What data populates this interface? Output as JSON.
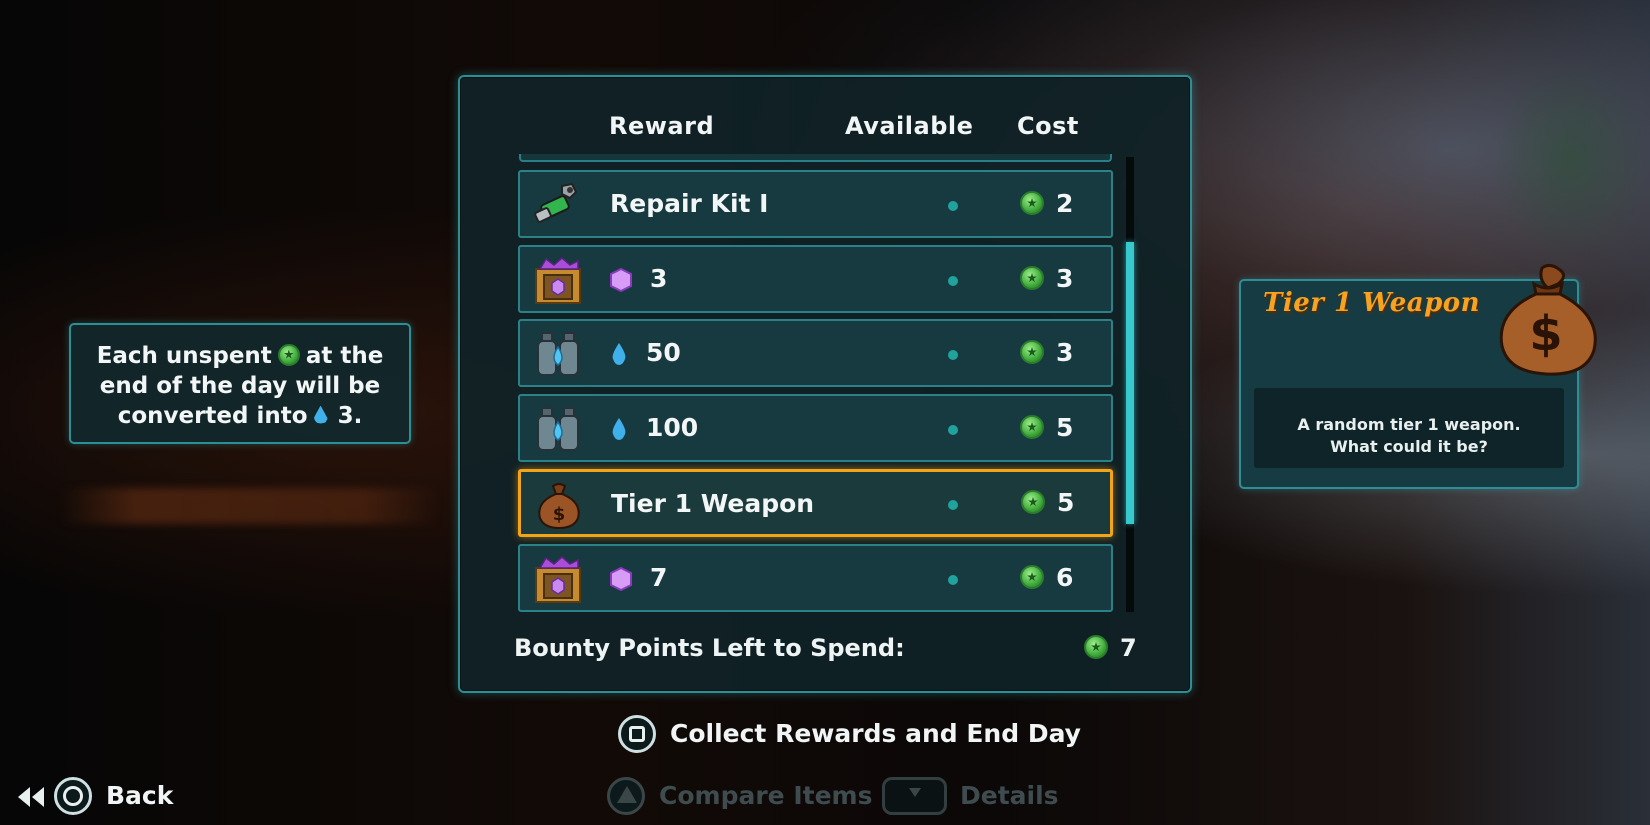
{
  "columns": {
    "reward": "Reward",
    "available": "Available",
    "cost": "Cost"
  },
  "rewards": [
    {
      "icon": "repair-kit-icon",
      "label": "Repair Kit I",
      "cost": "2"
    },
    {
      "icon": "gem-crate-icon",
      "mini_icon": "gem-icon",
      "label": "3",
      "cost": "3"
    },
    {
      "icon": "water-tank-icon",
      "mini_icon": "water-drop-icon",
      "label": "50",
      "cost": "3"
    },
    {
      "icon": "water-tank-icon",
      "mini_icon": "water-drop-icon",
      "label": "100",
      "cost": "5"
    },
    {
      "icon": "money-bag-icon",
      "label": "Tier 1 Weapon",
      "cost": "5",
      "selected": true
    },
    {
      "icon": "gem-crate-icon",
      "mini_icon": "gem-icon",
      "label": "7",
      "cost": "6"
    }
  ],
  "bounty": {
    "label": "Bounty Points Left to Spend:",
    "value": "7"
  },
  "info": {
    "line1_a": "Each unspent",
    "line1_b": "at the",
    "line2": "end of the day will be",
    "line3_a": "converted into",
    "line3_b": "3."
  },
  "detail": {
    "title": "Tier 1 Weapon",
    "desc_line1": "A random tier 1 weapon.",
    "desc_line2": "What could it be?"
  },
  "prompts": {
    "collect": "Collect Rewards and End Day",
    "back": "Back",
    "compare": "Compare Items",
    "details": "Details"
  },
  "colors": {
    "accent_teal": "#2c8f95",
    "selected_border": "#f2a51a",
    "title_orange": "#f5a321",
    "bounty_coin": "#3faa3a",
    "water": "#3fb0ea"
  }
}
